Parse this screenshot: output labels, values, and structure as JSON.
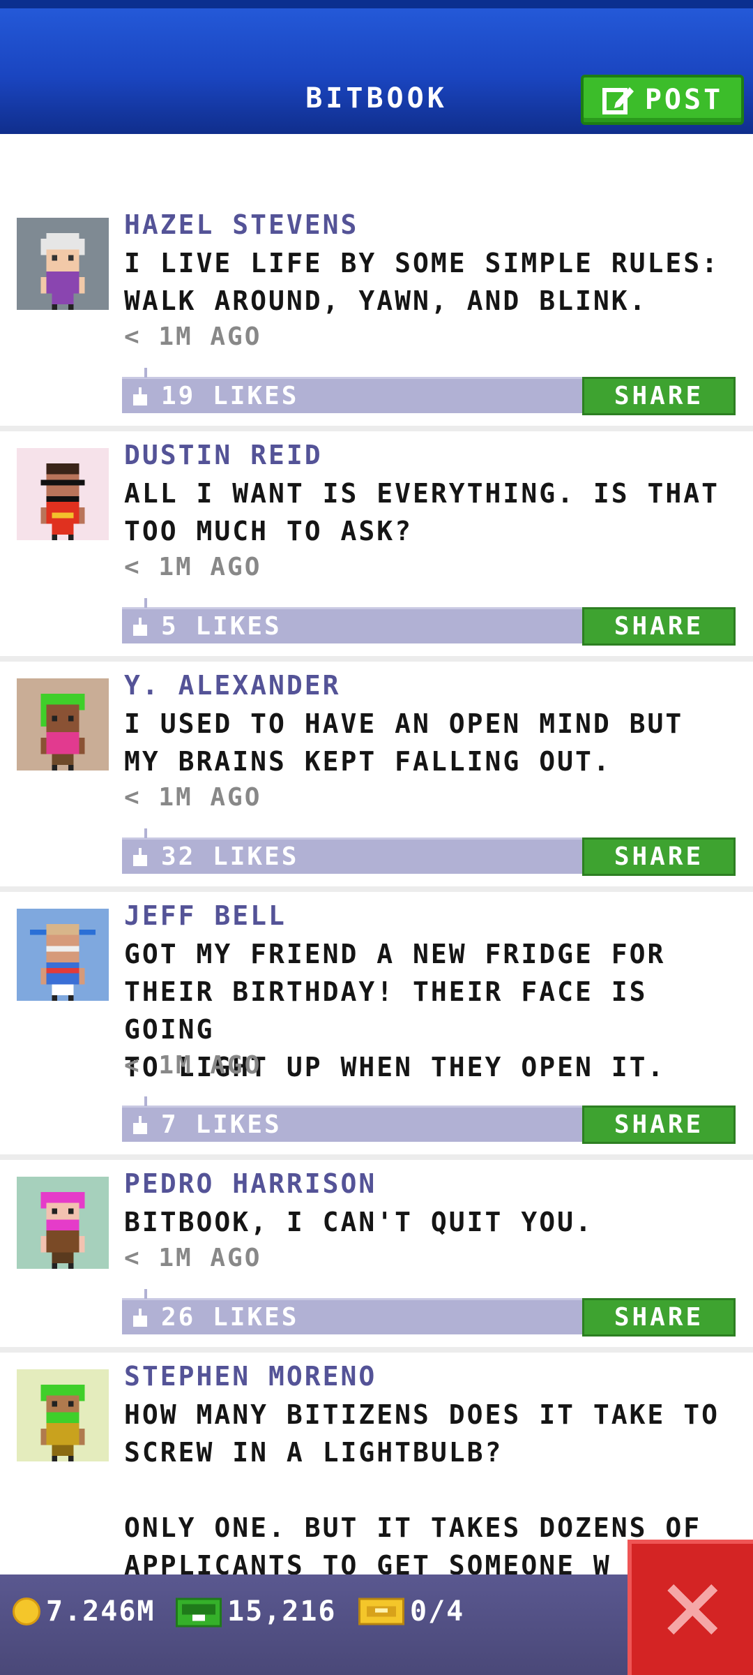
{
  "header": {
    "title": "BITBOOK",
    "post_label": "POST"
  },
  "posts": [
    {
      "author": "HAZEL STEVENS",
      "message": "I LIVE LIFE BY SOME SIMPLE RULES:\nWALK AROUND, YAWN, AND BLINK.",
      "time": "< 1M AGO",
      "likes": "19 LIKES",
      "share": "SHARE",
      "avatar_bg": "#7f8a93"
    },
    {
      "author": "DUSTIN REID",
      "message": "ALL I WANT IS EVERYTHING. IS THAT\nTOO MUCH TO ASK?",
      "time": "< 1M AGO",
      "likes": "5 LIKES",
      "share": "SHARE",
      "avatar_bg": "#f6e2ea"
    },
    {
      "author": "Y. ALEXANDER",
      "message": "I USED TO HAVE AN OPEN MIND BUT\nMY BRAINS KEPT FALLING OUT.",
      "time": "< 1M AGO",
      "likes": "32 LIKES",
      "share": "SHARE",
      "avatar_bg": "#c9ad96"
    },
    {
      "author": "JEFF BELL",
      "message": "GOT MY FRIEND A NEW FRIDGE FOR\nTHEIR BIRTHDAY! THEIR FACE IS GOING\nTO LIGHT UP WHEN THEY OPEN IT.",
      "time": "< 1M AGO",
      "likes": "7 LIKES",
      "share": "SHARE",
      "avatar_bg": "#7fa8de"
    },
    {
      "author": "PEDRO HARRISON",
      "message": "BITBOOK, I CAN'T QUIT YOU.",
      "time": "< 1M AGO",
      "likes": "26 LIKES",
      "share": "SHARE",
      "avatar_bg": "#a6d0bc"
    },
    {
      "author": "STEPHEN MORENO",
      "message": "HOW MANY BITIZENS DOES IT TAKE TO\nSCREW IN A LIGHTBULB?\n\nONLY ONE. BUT IT TAKES DOZENS OF\nAPPLICANTS TO GET SOMEONE W",
      "avatar_bg": "#e4ecbd"
    }
  ],
  "status": {
    "coins": "7.246M",
    "bux": "15,216",
    "vip": "0/4"
  },
  "colors": {
    "header_blue": "#1a45c0",
    "post_green": "#3cbd2a",
    "share_green": "#3ea330",
    "like_bar": "#b1b1d4",
    "author_purple": "#545397",
    "close_red": "#d42424"
  },
  "icons": {
    "post": "edit-icon",
    "like": "thumbs-up-icon",
    "coin": "coin-icon",
    "bux": "bux-icon",
    "vip": "vip-ticket-icon",
    "close": "close-icon"
  }
}
